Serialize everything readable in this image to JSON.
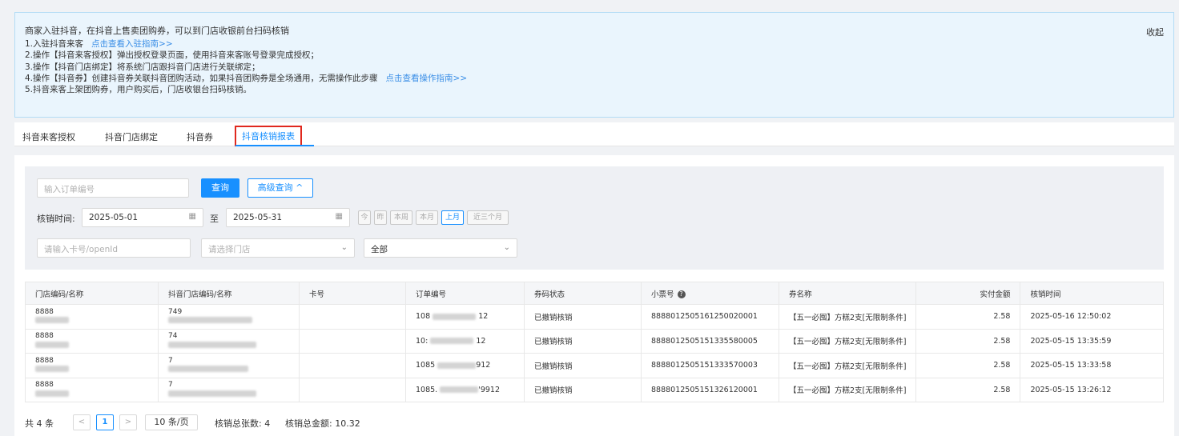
{
  "notice": {
    "title": "商家入驻抖音，在抖音上售卖团购券，可以到门店收银前台扫码核销",
    "line1": "1.入驻抖音来客",
    "line1_link": "点击查看入驻指南>>",
    "line2": "2.操作【抖音来客授权】弹出授权登录页面，使用抖音来客账号登录完成授权；",
    "line3": "3.操作【抖音门店绑定】将系统门店跟抖音门店进行关联绑定；",
    "line4": "4.操作【抖音券】创建抖音券关联抖音团购活动，如果抖音团购券是全场通用，无需操作此步骤",
    "line4_link": "点击查看操作指南>>",
    "line5": "5.抖音来客上架团购券，用户购买后，门店收银台扫码核销。",
    "collapse": "收起"
  },
  "tabs": [
    "抖音来客授权",
    "抖音门店绑定",
    "抖音券",
    "抖音核销报表"
  ],
  "filter": {
    "order_placeholder": "输入订单编号",
    "query_btn": "查询",
    "advanced_btn": "高级查询 ^",
    "time_label": "核销时间:",
    "date_from": "2025-05-01",
    "to_label": "至",
    "date_to": "2025-05-31",
    "quick": [
      "今",
      "昨",
      "本周",
      "本月",
      "上月",
      "近三个月"
    ],
    "card_placeholder": "请输入卡号/openId",
    "store_placeholder": "请选择门店",
    "status_value": "全部"
  },
  "table": {
    "headers": [
      "门店编码/名称",
      "抖音门店编码/名称",
      "卡号",
      "订单编号",
      "券码状态",
      "小票号",
      "券名称",
      "实付金额",
      "核销时间"
    ],
    "rows": [
      {
        "store_code": "8888",
        "dy_code": "749",
        "order_pre": "108",
        "order_suf": "12",
        "status": "已撤销核销",
        "ticket": "8888012505161250020001",
        "coupon": "【五一必囤】方糕2支[无限制条件]",
        "amount": "2.58",
        "time": "2025-05-16 12:50:02"
      },
      {
        "store_code": "8888",
        "dy_code": "74",
        "order_pre": "10:",
        "order_suf": "12",
        "status": "已撤销核销",
        "ticket": "8888012505151335580005",
        "coupon": "【五一必囤】方糕2支[无限制条件]",
        "amount": "2.58",
        "time": "2025-05-15 13:35:59"
      },
      {
        "store_code": "8888",
        "dy_code": "7",
        "order_pre": "1085",
        "order_suf": "912",
        "status": "已撤销核销",
        "ticket": "8888012505151333570003",
        "coupon": "【五一必囤】方糕2支[无限制条件]",
        "amount": "2.58",
        "time": "2025-05-15 13:33:58"
      },
      {
        "store_code": "8888",
        "dy_code": "7",
        "order_pre": "1085.",
        "order_suf": "'9912",
        "status": "已撤销核销",
        "ticket": "8888012505151326120001",
        "coupon": "【五一必囤】方糕2支[无限制条件]",
        "amount": "2.58",
        "time": "2025-05-15 13:26:12"
      }
    ]
  },
  "pager": {
    "total": "共 4 条",
    "prev": "<",
    "page": "1",
    "next": ">",
    "size": "10 条/页",
    "count_label": "核销总张数: 4",
    "sum_label": "核销总金额: 10.32"
  }
}
